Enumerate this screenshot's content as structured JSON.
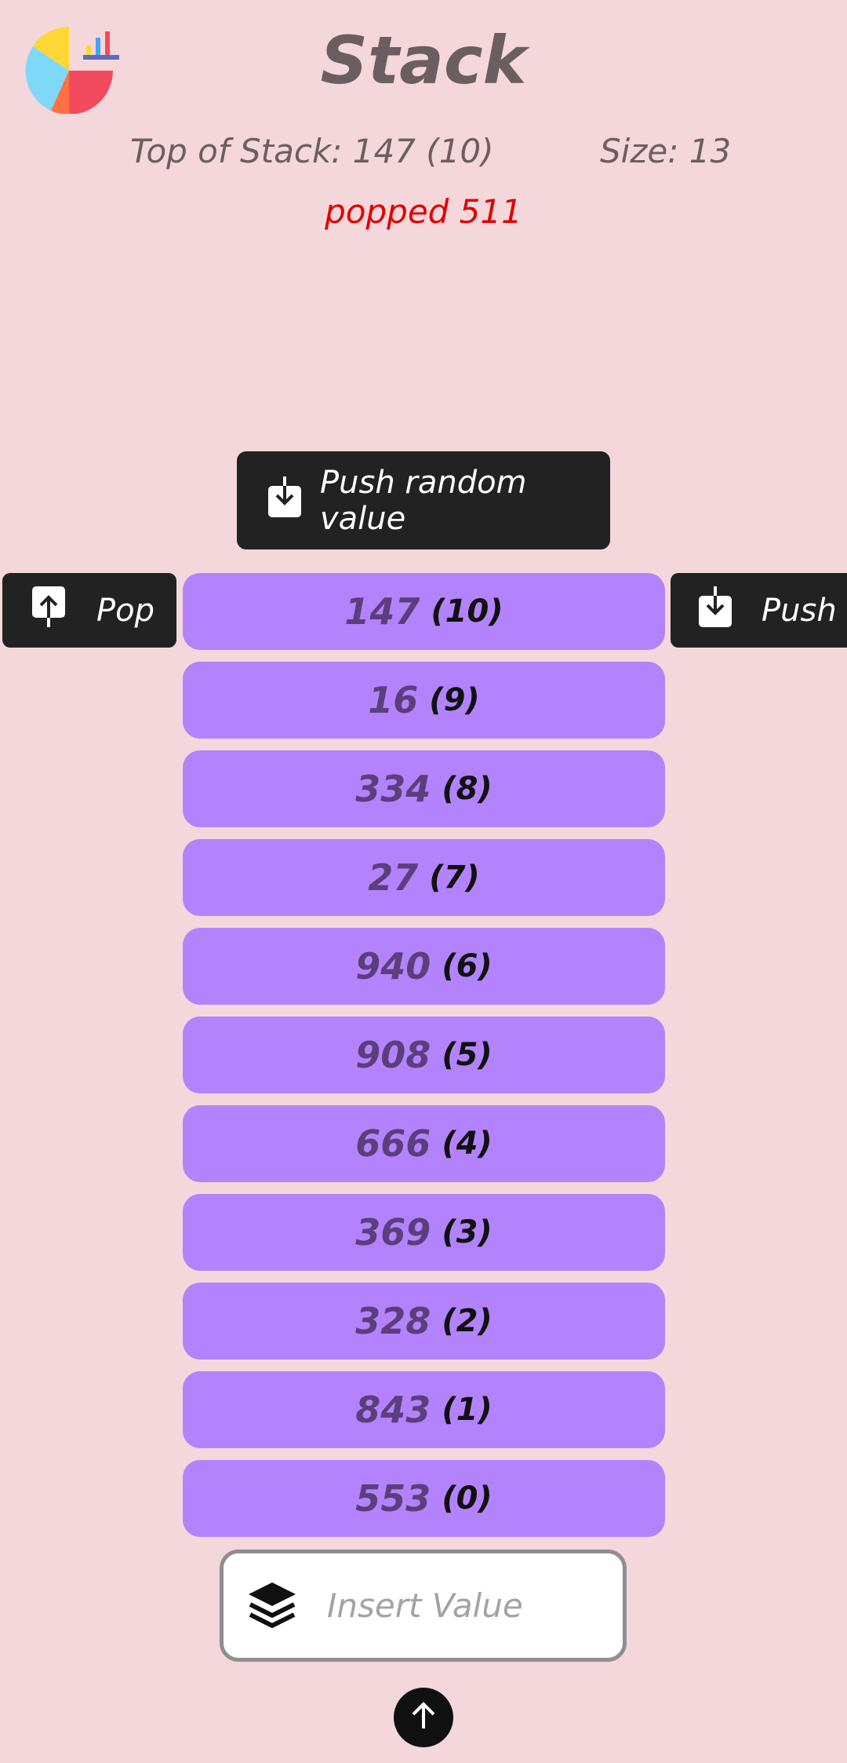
{
  "header": {
    "title": "Stack",
    "top_of_stack": "Top of Stack: 147 (10)",
    "size": "Size: 13",
    "status": "popped 511"
  },
  "buttons": {
    "push_random": "Push random value",
    "pop": "Pop",
    "push": "Push"
  },
  "stack": [
    {
      "value": "147",
      "index": "(10)"
    },
    {
      "value": "16",
      "index": "(9)"
    },
    {
      "value": "334",
      "index": "(8)"
    },
    {
      "value": "27",
      "index": "(7)"
    },
    {
      "value": "940",
      "index": "(6)"
    },
    {
      "value": "908",
      "index": "(5)"
    },
    {
      "value": "666",
      "index": "(4)"
    },
    {
      "value": "369",
      "index": "(3)"
    },
    {
      "value": "328",
      "index": "(2)"
    },
    {
      "value": "843",
      "index": "(1)"
    },
    {
      "value": "553",
      "index": "(0)"
    }
  ],
  "input": {
    "placeholder": "Insert Value",
    "value": ""
  },
  "icons": {
    "logo": "pie-chart-logo-icon",
    "push_random": "download-icon",
    "pop": "upload-icon",
    "push": "download-icon",
    "input": "layers-icon",
    "submit": "arrow-up-icon"
  },
  "colors": {
    "background": "#f4d7db",
    "stack_item": "#b383fd",
    "button": "#222222",
    "status": "#e00000",
    "text": "#6b5e61"
  }
}
